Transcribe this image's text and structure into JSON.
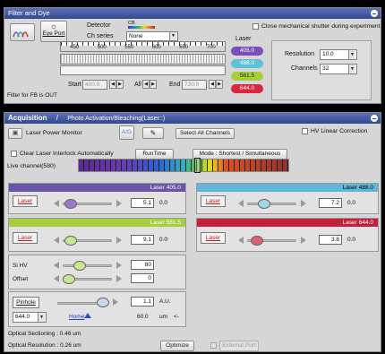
{
  "filter": {
    "title": "Filter and Dye",
    "eye_port_label": "Eye Port",
    "detector_label": "Detector",
    "cb_label": "CB",
    "ch_series_label": "Ch series",
    "ch_series_value": "None",
    "laser_header": "Laser",
    "ruler_ticks": [
      "450",
      "500",
      "550",
      "600",
      "650",
      "700"
    ],
    "start_label": "Start",
    "start_value": "400.0",
    "all_label": "All",
    "end_label": "End",
    "end_value": "720.0",
    "fb_status": "Filter for FB is OUT",
    "lasers": [
      {
        "label": "405.0",
        "color": "#7a4fb8"
      },
      {
        "label": "488.0",
        "color": "#5fc0d8"
      },
      {
        "label": "561.5",
        "color": "#a8cf3a"
      },
      {
        "label": "644.0",
        "color": "#d7263d"
      }
    ],
    "mech_shutter_label": "Close mechanical shutter during experiment",
    "resolution_label": "Resolution",
    "resolution_value": "10.0",
    "channels_label": "Channels",
    "channels_value": "32"
  },
  "acq": {
    "title": "Acquisition",
    "separator": "/",
    "title2": "Photo Activation/Bleaching(Laser::)",
    "laser_power_monitor_label": "Laser Power Monitor",
    "ag_label": "A/G",
    "select_all_label": "Select All Channels",
    "hv_linear_label": "HV Linear Correction",
    "clear_interlock_label": "Clear Laser Interlock Automatically",
    "runtime_label": "RunTime",
    "mode_label": "Mode : Shortest / Simultaneous",
    "live_channel_label": "Live channel(580)",
    "laser_panels": [
      {
        "header": "Laser 405.0",
        "button": "Laser",
        "value": "5.1",
        "extra": "0.0",
        "color": "#6a54a8",
        "knob": "#9a7ad0",
        "level": 0.28
      },
      {
        "header": "Laser 488.0",
        "button": "Laser",
        "value": "7.2",
        "extra": "0.0",
        "color": "#5fb8d8",
        "knob": "#a0d8ea",
        "level": 0.35
      },
      {
        "header": "Laser 561.5",
        "button": "Laser",
        "value": "9.1",
        "extra": "0.0",
        "color": "#a8cf3a",
        "knob": "#c8e890",
        "level": 0.28
      },
      {
        "header": "Laser 644.0",
        "button": "Laser",
        "value": "3.8",
        "extra": "0.0",
        "color": "#c41e3a",
        "knob": "#e06070",
        "level": 0.2
      }
    ],
    "si_hv_label": "Si HV",
    "si_hv_value": "80",
    "offset_label": "Offset",
    "offset_value": "0",
    "pinhole_label": "Pinhole",
    "pinhole_select": "644.0",
    "home_label": "Home",
    "au_value": "1.1",
    "au_unit": "A.U.",
    "um_value": "60.0",
    "um_unit": "um",
    "arrow_label": "<-",
    "optical_sectioning": "Optical Sectioning : 0.46 um",
    "optical_resolution": "Optical Resolution : 0.26 um",
    "optimize_label": "Optimize",
    "external_port_label": "External Port"
  }
}
